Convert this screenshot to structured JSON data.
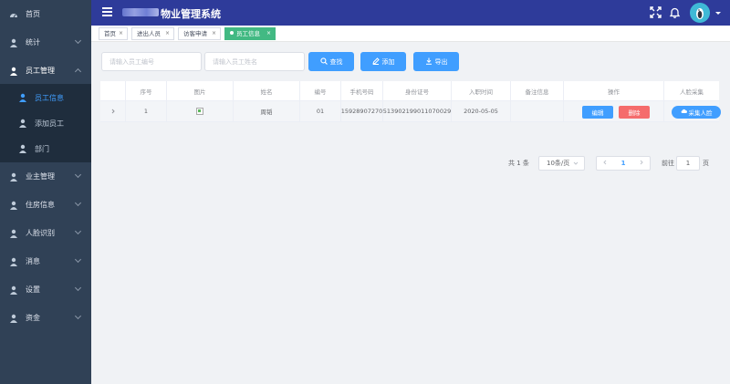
{
  "header": {
    "app_title": "物业管理系统",
    "menu_icon": "hamburger-icon",
    "fullscreen_icon": "fullscreen-icon",
    "bell_icon": "bell-icon"
  },
  "sidebar": {
    "items": [
      {
        "label": "首页",
        "icon": "dashboard-icon"
      },
      {
        "label": "统计",
        "icon": "user-icon"
      },
      {
        "label": "员工管理",
        "icon": "user-icon"
      },
      {
        "label": "业主管理",
        "icon": "user-icon"
      },
      {
        "label": "住房信息",
        "icon": "user-icon"
      },
      {
        "label": "人脸识别",
        "icon": "user-icon"
      },
      {
        "label": "消息",
        "icon": "user-icon"
      },
      {
        "label": "设置",
        "icon": "user-icon"
      },
      {
        "label": "资金",
        "icon": "user-icon"
      }
    ],
    "submenu": [
      {
        "label": "员工信息",
        "icon": "user-icon"
      },
      {
        "label": "添加员工",
        "icon": "user-icon"
      },
      {
        "label": "部门",
        "icon": "user-icon"
      }
    ]
  },
  "tags": [
    {
      "label": "首页"
    },
    {
      "label": "进出人员"
    },
    {
      "label": "访客申请"
    },
    {
      "label": "员工信息"
    }
  ],
  "search": {
    "number_placeholder": "请输入员工编号",
    "name_placeholder": "请输入员工姓名",
    "search_label": "查找",
    "add_label": "添加",
    "export_label": "导出"
  },
  "table": {
    "columns": [
      "序号",
      "图片",
      "姓名",
      "编号",
      "手机号码",
      "身份证号",
      "入职时间",
      "备注信息",
      "操作",
      "人脸采集"
    ],
    "rows": [
      {
        "index": "1",
        "name": "周韬",
        "number": "01",
        "phone": "15928907270",
        "id_card": "513902199011070029",
        "join_date": "2020-05-05",
        "remark": "",
        "edit_label": "编辑",
        "delete_label": "删除",
        "face_label": "采集人脸"
      }
    ]
  },
  "pagination": {
    "total": "共 1 条",
    "page_size": "10条/页",
    "current_page": "1",
    "goto_label": "前往",
    "goto_value": "1",
    "page_suffix": "页"
  },
  "colors": {
    "header_bg": "#2e3b9a",
    "sidebar_bg": "#304156",
    "primary": "#409eff",
    "danger": "#f56c6c",
    "active_tag": "#42b983"
  }
}
